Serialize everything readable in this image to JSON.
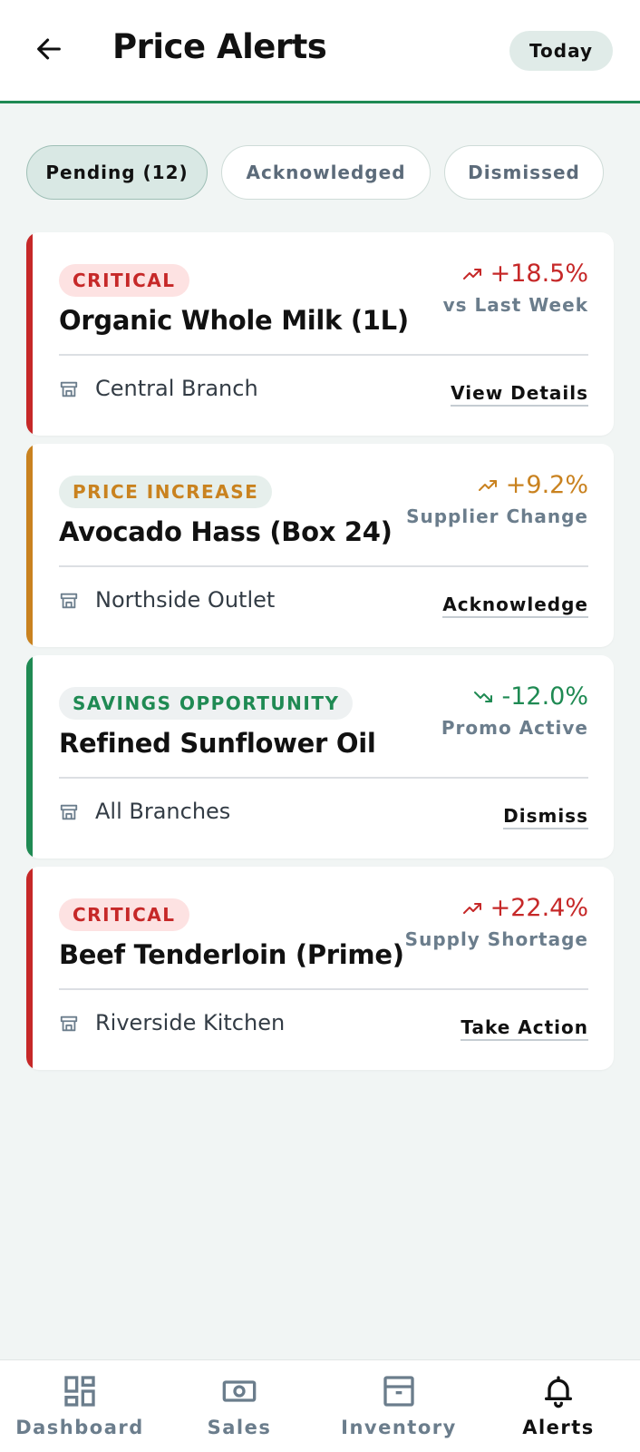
{
  "header": {
    "title": "Price Alerts",
    "period": "Today"
  },
  "tabs": [
    {
      "label": "Pending (12)",
      "active": true
    },
    {
      "label": "Acknowledged",
      "active": false
    },
    {
      "label": "Dismissed",
      "active": false
    }
  ],
  "alerts": [
    {
      "badge": "CRITICAL",
      "product": "Organic Whole Milk (1L)",
      "change": "+18.5%",
      "trend": "up",
      "reason": "vs Last Week",
      "store": "Central Branch",
      "action": "View Details",
      "color": "#c62828"
    },
    {
      "badge": "PRICE INCREASE",
      "product": "Avocado Hass (Box 24)",
      "change": "+9.2%",
      "trend": "up",
      "reason": "Supplier Change",
      "store": "Northside Outlet",
      "action": "Acknowledge",
      "color": "#c9821f"
    },
    {
      "badge": "SAVINGS OPPORTUNITY",
      "product": "Refined Sunflower Oil",
      "change": "-12.0%",
      "trend": "down",
      "reason": "Promo Active",
      "store": "All Branches",
      "action": "Dismiss",
      "color": "#1f8a53"
    },
    {
      "badge": "CRITICAL",
      "product": "Beef Tenderloin (Prime)",
      "change": "+22.4%",
      "trend": "up",
      "reason": "Supply Shortage",
      "store": "Riverside Kitchen",
      "action": "Take Action",
      "color": "#c62828"
    }
  ],
  "nav": [
    {
      "label": "Dashboard",
      "icon": "dashboard-icon",
      "active": false
    },
    {
      "label": "Sales",
      "icon": "cash-icon",
      "active": false
    },
    {
      "label": "Inventory",
      "icon": "archive-box-icon",
      "active": false
    },
    {
      "label": "Alerts",
      "icon": "bell-icon",
      "active": true
    }
  ],
  "colors": {
    "brand": "#1f8a53",
    "critical": "#c62828",
    "warning": "#c9821f",
    "background": "#f1f5f4"
  }
}
